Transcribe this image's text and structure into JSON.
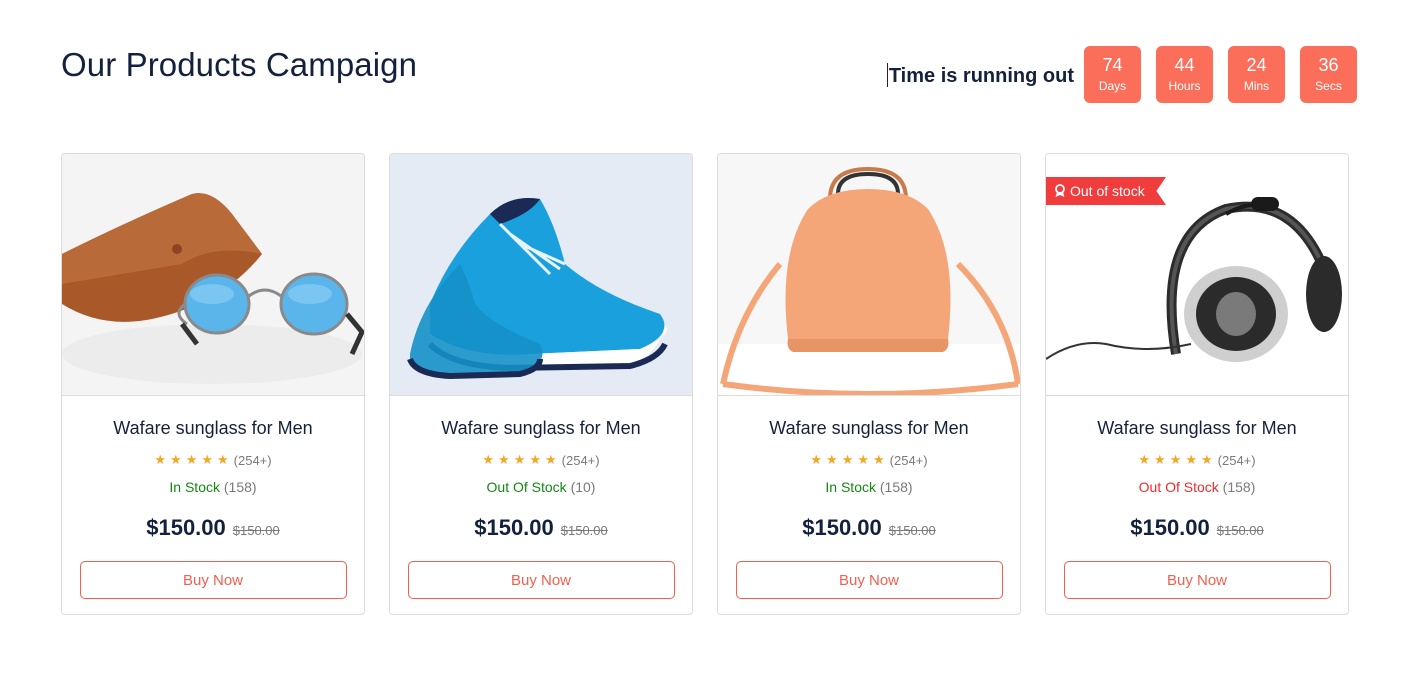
{
  "page": {
    "title": "Our Products Campaign"
  },
  "countdown": {
    "label": "Time is running out",
    "boxes": [
      {
        "value": "74",
        "unit": "Days"
      },
      {
        "value": "44",
        "unit": "Hours"
      },
      {
        "value": "24",
        "unit": "Mins"
      },
      {
        "value": "36",
        "unit": "Secs"
      }
    ]
  },
  "colors": {
    "accent": "#fa6e5a",
    "in_stock": "#118a11",
    "out_of_stock": "#ee2b2b",
    "star": "#f5a623",
    "text": "#14213d"
  },
  "products": [
    {
      "image_icon": "sunglasses-image",
      "badge": "",
      "name": "Wafare sunglass for Men",
      "rating_stars": 5,
      "rating_count": "(254+)",
      "stock_status": "In Stock",
      "stock_count": "(158)",
      "price": "$150.00",
      "old_price": "$150.00",
      "button": "Buy Now"
    },
    {
      "image_icon": "sneakers-image",
      "badge": "",
      "name": "Wafare sunglass for Men",
      "rating_stars": 5,
      "rating_count": "(254+)",
      "stock_status": "Out Of Stock",
      "stock_count": "(10)",
      "price": "$150.00",
      "old_price": "$150.00",
      "button": "Buy Now"
    },
    {
      "image_icon": "handbag-image",
      "badge": "",
      "name": "Wafare sunglass for Men",
      "rating_stars": 5,
      "rating_count": "(254+)",
      "stock_status": "In Stock",
      "stock_count": "(158)",
      "price": "$150.00",
      "old_price": "$150.00",
      "button": "Buy Now"
    },
    {
      "image_icon": "headset-image",
      "badge": "Out of stock",
      "name": "Wafare sunglass for Men",
      "rating_stars": 5,
      "rating_count": "(254+)",
      "stock_status": "Out Of Stock",
      "stock_count": "(158)",
      "price": "$150.00",
      "old_price": "$150.00",
      "button": "Buy Now"
    }
  ]
}
